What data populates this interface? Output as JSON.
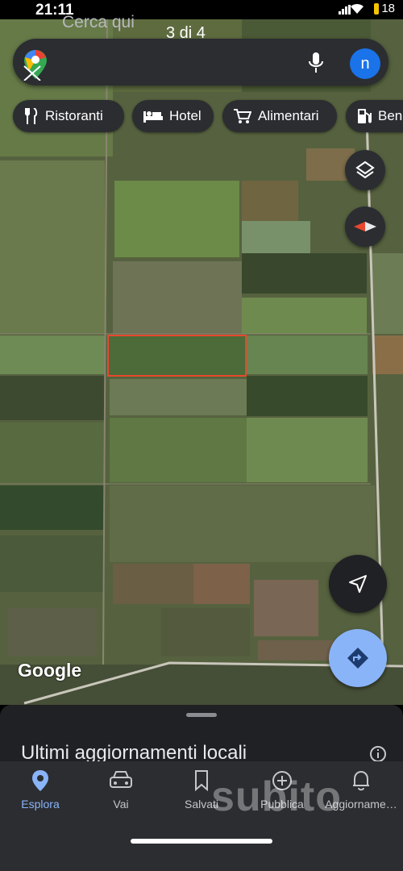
{
  "status": {
    "time": "21:11",
    "battery": "18"
  },
  "search": {
    "placeholder": "Cerca qui",
    "counter": "3 di 4",
    "avatar_letter": "n"
  },
  "chips": [
    {
      "label": "Ristoranti",
      "icon": "fork-knife-icon"
    },
    {
      "label": "Hotel",
      "icon": "bed-icon"
    },
    {
      "label": "Alimentari",
      "icon": "cart-icon"
    },
    {
      "label": "Ben",
      "icon": "fuel-icon"
    }
  ],
  "map": {
    "attribution": "Google",
    "highlight_color": "#e8472e"
  },
  "sheet": {
    "title": "Ultimi aggiornamenti locali"
  },
  "nav": [
    {
      "label": "Esplora",
      "icon": "pin-icon",
      "active": true
    },
    {
      "label": "Vai",
      "icon": "car-icon"
    },
    {
      "label": "Salvati",
      "icon": "bookmark-icon"
    },
    {
      "label": "Pubblica",
      "icon": "plus-circle-icon"
    },
    {
      "label": "Aggiorname…",
      "icon": "bell-icon"
    }
  ],
  "watermark": "subito",
  "colors": {
    "accent": "#8ab4f8",
    "primary_blue": "#1a73e8",
    "directions_fab": "#8ab4f8"
  }
}
